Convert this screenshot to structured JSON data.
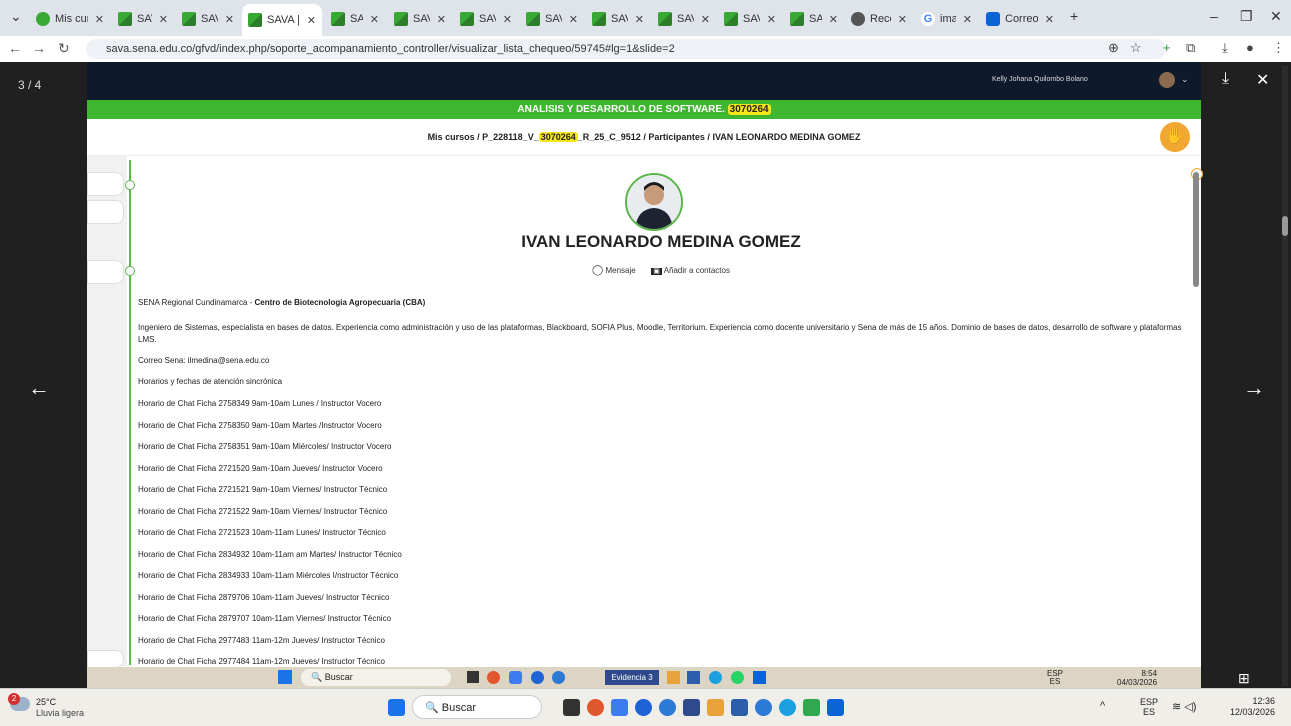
{
  "browser": {
    "tabs": [
      {
        "label": "Mis cur",
        "icon": "green-circle-icon"
      },
      {
        "label": "SAVA |",
        "icon": "sava-icon"
      },
      {
        "label": "SAVA |",
        "icon": "sava-icon"
      },
      {
        "label": "SAVA |",
        "icon": "sava-icon",
        "active": true
      },
      {
        "label": "SAVA |",
        "icon": "sava-icon"
      },
      {
        "label": "SAVA |",
        "icon": "sava-icon"
      },
      {
        "label": "SAVA |",
        "icon": "sava-icon"
      },
      {
        "label": "SAVA |",
        "icon": "sava-icon"
      },
      {
        "label": "SAVA |",
        "icon": "sava-icon"
      },
      {
        "label": "SAVA |",
        "icon": "sava-icon"
      },
      {
        "label": "SAVA |",
        "icon": "sava-icon"
      },
      {
        "label": "SAVA |",
        "icon": "sava-icon"
      },
      {
        "label": "Record",
        "icon": "record-icon"
      },
      {
        "label": "imagen",
        "icon": "google-icon"
      },
      {
        "label": "Correo",
        "icon": "mail-icon"
      }
    ],
    "new_tab": "+",
    "url": "sava.sena.edu.co/gfvd/index.php/soporte_acompanamiento_controller/visualizar_lista_chequeo/59745#lg=1&slide=2"
  },
  "viewer": {
    "counter": "3 / 4"
  },
  "page": {
    "top_user": "Kelly Johana Quilombo Bolano",
    "banner_prefix": "ANALISIS Y DESARROLLO DE SOFTWARE.",
    "banner_code": "3070264",
    "crumb_1": "Mis cursos",
    "crumb_2a": "P_228118_V_",
    "crumb_2b": "3070264",
    "crumb_2c": "_R_25_C_9512",
    "crumb_3": "Participantes",
    "crumb_4": "IVAN LEONARDO MEDINA GOMEZ",
    "sep": "/",
    "name": "IVAN LEONARDO MEDINA GOMEZ",
    "msg_label": "Mensaje",
    "add_label": "Añadir a contactos",
    "regional": "SENA Regional Cundinamarca - ",
    "center": "Centro de Biotecnologia Agropecuaria (CBA)",
    "bio": "Ingeniero de Sistemas, especialista en bases de datos. Experiencia como administración y uso de las plataformas, Blackboard, SOFIA Plus, Moodle, Territorium. Experiencia como docente universitario y Sena de más de 15 años.  Dominio de bases de datos, desarrollo de software y plataformas LMS.",
    "email": "Correo Sena: ilmedina@sena.edu.co",
    "schedule_title": "Horarios y fechas de atención sincrónica",
    "schedule": [
      "Horario de Chat  Ficha 2758349 9am-10am Lunes / Instructor Vocero",
      "Horario de Chat  Ficha 2758350 9am-10am Martes /Instructor Vocero",
      "Horario de Chat  Ficha 2758351 9am-10am Miércoles/ Instructor Vocero",
      "Horario de Chat  Ficha 2721520 9am-10am Jueves/ Instructor Vocero",
      "Horario de Chat  Ficha 2721521 9am-10am Viernes/ Instructor Técnico",
      "Horario de Chat  Ficha 2721522 9am-10am Viernes/ Instructor Técnico",
      "Horario de Chat  Ficha 2721523 10am-11am Lunes/ Instructor Técnico",
      "Horario de Chat  Ficha 2834932 10am-11am am Martes/ Instructor Técnico",
      "Horario de Chat  Ficha 2834933 10am-11am Miércoles I/nstructor Técnico",
      "Horario de Chat  Ficha 2879706 10am-11am Jueves/ Instructor Técnico",
      "Horario de Chat  Ficha 2879707 10am-11am Viernes/ Instructor Técnico",
      "Horario de Chat  Ficha 2977483 11am-12m Jueves/ Instructor Técnico",
      "Horario de Chat  Ficha 2977484 11am-12m Jueves/ Instructor Técnico"
    ]
  },
  "inner_taskbar": {
    "search": "Buscar",
    "task_label": "Evidencia 3",
    "lang_1": "ESP",
    "lang_2": "ES",
    "time": "8:54",
    "date": "04/03/2026"
  },
  "taskbar": {
    "weather_temp": "25°C",
    "weather_desc": "Lluvia ligera",
    "badge": "2",
    "search": "Buscar",
    "lang_1": "ESP",
    "lang_2": "ES",
    "time": "12:36",
    "date": "12/03/2026"
  },
  "colors": {
    "banner_green": "#3fb630",
    "highlight": "#f7e51a",
    "help_orange": "#f2a733",
    "header_dark": "#0e1a2b"
  }
}
